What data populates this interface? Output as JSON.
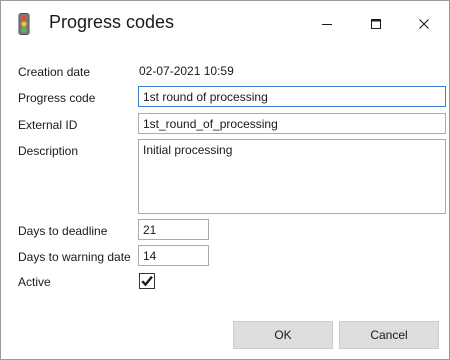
{
  "window": {
    "title": "Progress codes",
    "icon": "traffic-light-icon",
    "controls": [
      "minimize-icon",
      "maximize-icon",
      "close-icon"
    ]
  },
  "form": {
    "creation_date": {
      "label": "Creation date",
      "value": "02-07-2021 10:59"
    },
    "progress_code": {
      "label": "Progress code",
      "value": "1st round of processing"
    },
    "external_id": {
      "label": "External ID",
      "value": "1st_round_of_processing"
    },
    "description": {
      "label": "Description",
      "value": "Initial processing"
    },
    "days_to_deadline": {
      "label": "Days to deadline",
      "value": "21"
    },
    "days_to_warning": {
      "label": "Days to warning date",
      "value": "14"
    },
    "active": {
      "label": "Active",
      "checked": true
    }
  },
  "buttons": {
    "ok": "OK",
    "cancel": "Cancel"
  },
  "colors": {
    "focus_border": "#3b7fd6",
    "field_border": "#ababab",
    "button_bg": "#dddddd",
    "traffic_red": "#e64a3b",
    "traffic_yellow": "#f2c230",
    "traffic_green": "#5cb85c"
  }
}
